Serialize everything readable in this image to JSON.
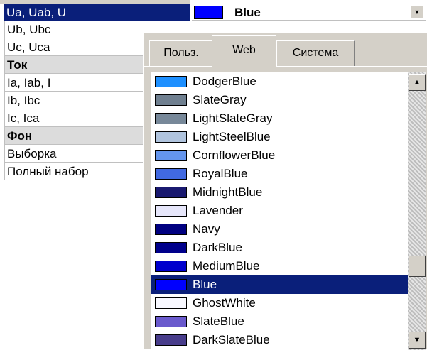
{
  "property_grid": {
    "selected_label": "Ua, Uab, U",
    "rows": [
      {
        "label": "Ub, Ubc",
        "category": false
      },
      {
        "label": "Uc, Uca",
        "category": false
      },
      {
        "label": "Ток",
        "category": true
      },
      {
        "label": "Ia, Iab, I",
        "category": false
      },
      {
        "label": "Ib, Ibc",
        "category": false
      },
      {
        "label": "Ic, Ica",
        "category": false
      },
      {
        "label": "Фон",
        "category": true
      },
      {
        "label": "Выборка",
        "category": false
      },
      {
        "label": "Полный набор",
        "category": false
      }
    ]
  },
  "value_editor": {
    "value": "Blue",
    "swatch_color": "#0000FF",
    "dropdown_icon": "chevron-down-icon"
  },
  "color_picker": {
    "tabs": [
      "Польз.",
      "Web",
      "Система"
    ],
    "active_tab": "Web",
    "selected": "Blue",
    "colors": [
      {
        "name": "DodgerBlue",
        "hex": "#1E90FF"
      },
      {
        "name": "SlateGray",
        "hex": "#708090"
      },
      {
        "name": "LightSlateGray",
        "hex": "#778899"
      },
      {
        "name": "LightSteelBlue",
        "hex": "#B0C4DE"
      },
      {
        "name": "CornflowerBlue",
        "hex": "#6495ED"
      },
      {
        "name": "RoyalBlue",
        "hex": "#4169E1"
      },
      {
        "name": "MidnightBlue",
        "hex": "#191970"
      },
      {
        "name": "Lavender",
        "hex": "#E6E6FA"
      },
      {
        "name": "Navy",
        "hex": "#000080"
      },
      {
        "name": "DarkBlue",
        "hex": "#00008B"
      },
      {
        "name": "MediumBlue",
        "hex": "#0000CD"
      },
      {
        "name": "Blue",
        "hex": "#0000FF"
      },
      {
        "name": "GhostWhite",
        "hex": "#F8F8FF"
      },
      {
        "name": "SlateBlue",
        "hex": "#6A5ACD"
      },
      {
        "name": "DarkSlateBlue",
        "hex": "#483D8B"
      }
    ],
    "scroll_position": 0.75,
    "scroll_up_icon": "arrow-up-icon",
    "scroll_down_icon": "arrow-down-icon"
  }
}
